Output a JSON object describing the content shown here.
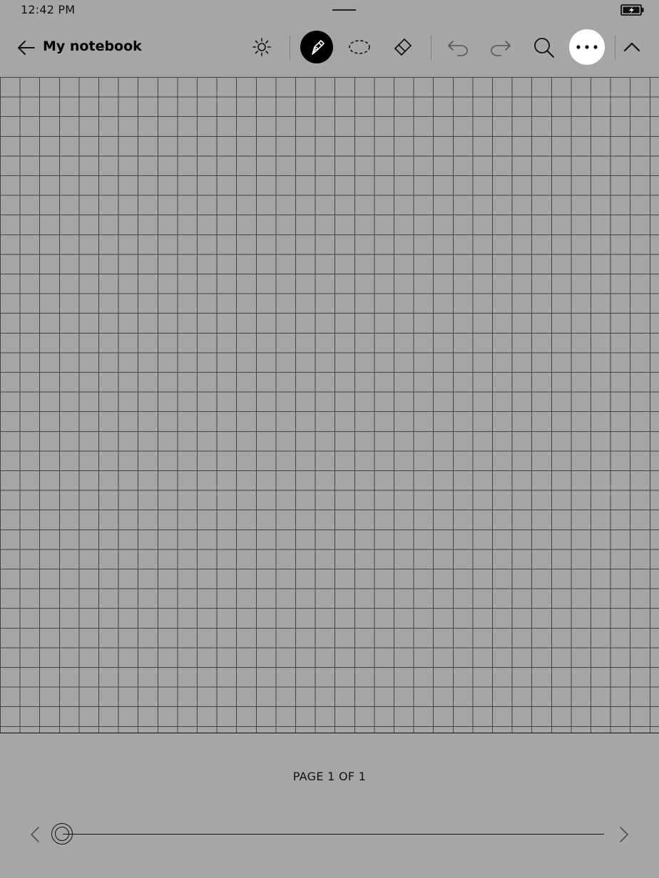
{
  "status": {
    "time": "12:42 PM",
    "battery_icon": "battery-charging-icon"
  },
  "toolbar": {
    "back_icon": "arrow-left-icon",
    "title": "My notebook",
    "tools": [
      {
        "name": "brightness",
        "icon": "sun-icon"
      },
      {
        "name": "pen",
        "icon": "fountain-pen-icon",
        "selected": true
      },
      {
        "name": "lasso",
        "icon": "lasso-select-icon"
      },
      {
        "name": "eraser",
        "icon": "eraser-icon"
      },
      {
        "name": "undo",
        "icon": "undo-icon"
      },
      {
        "name": "redo",
        "icon": "redo-icon"
      },
      {
        "name": "search",
        "icon": "search-icon"
      },
      {
        "name": "more",
        "icon": "more-horizontal-icon"
      },
      {
        "name": "collapse",
        "icon": "chevron-up-icon"
      }
    ]
  },
  "canvas": {
    "template": "grid"
  },
  "footer": {
    "page_indicator": "PAGE 1 OF 1",
    "page_progress": 0,
    "prev_icon": "chevron-left-icon",
    "next_icon": "chevron-right-icon"
  },
  "colors": {
    "background": "#a6a6a6",
    "ink": "#000000",
    "grid_line": "#444444"
  }
}
